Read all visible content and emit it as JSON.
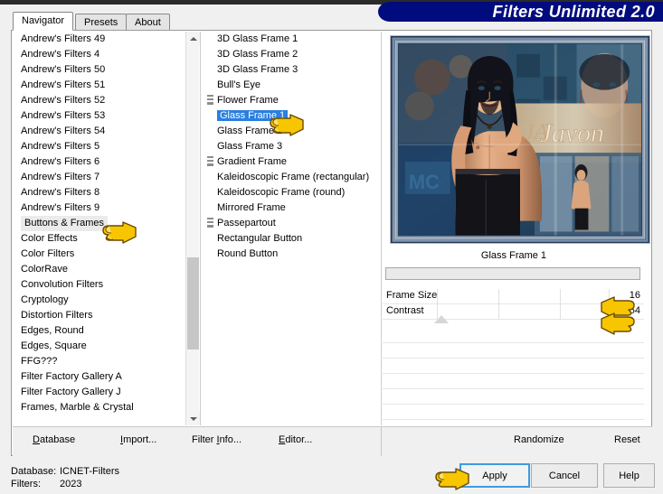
{
  "window": {
    "banner_title": "Filters Unlimited 2.0",
    "banner_color": "#000b7e"
  },
  "tabs": [
    {
      "label": "Navigator",
      "active": true
    },
    {
      "label": "Presets",
      "active": false
    },
    {
      "label": "About",
      "active": false
    }
  ],
  "categories": {
    "selected": "Buttons & Frames",
    "items": [
      "Andrew's Filters 49",
      "Andrew's Filters 4",
      "Andrew's Filters 50",
      "Andrew's Filters 51",
      "Andrew's Filters 52",
      "Andrew's Filters 53",
      "Andrew's Filters 54",
      "Andrew's Filters 5",
      "Andrew's Filters 6",
      "Andrew's Filters 7",
      "Andrew's Filters 8",
      "Andrew's Filters 9",
      "Buttons & Frames",
      "Color Effects",
      "Color Filters",
      "ColorRave",
      "Convolution Filters",
      "Cryptology",
      "Distortion Filters",
      "Edges, Round",
      "Edges, Square",
      "FFG???",
      "Filter Factory Gallery A",
      "Filter Factory Gallery J",
      "Frames, Marble & Crystal"
    ]
  },
  "filters": {
    "selected": "Glass Frame 1",
    "items": [
      {
        "label": "3D Glass Frame 1",
        "icon": false
      },
      {
        "label": "3D Glass Frame 2",
        "icon": false
      },
      {
        "label": "3D Glass Frame 3",
        "icon": false
      },
      {
        "label": "Bull's Eye",
        "icon": false
      },
      {
        "label": "Flower Frame",
        "icon": true
      },
      {
        "label": "Glass Frame 1",
        "icon": false
      },
      {
        "label": "Glass Frame 2",
        "icon": false
      },
      {
        "label": "Glass Frame 3",
        "icon": false
      },
      {
        "label": "Gradient Frame",
        "icon": true
      },
      {
        "label": "Kaleidoscopic Frame (rectangular)",
        "icon": false
      },
      {
        "label": "Kaleidoscopic Frame (round)",
        "icon": false
      },
      {
        "label": "Mirrored Frame",
        "icon": false
      },
      {
        "label": "Passepartout",
        "icon": true
      },
      {
        "label": "Rectangular Button",
        "icon": false
      },
      {
        "label": "Round Button",
        "icon": false
      }
    ]
  },
  "preview": {
    "caption": "Glass Frame 1",
    "artwork_text": "Javon"
  },
  "parameters": [
    {
      "label": "Frame Size",
      "value": "16"
    },
    {
      "label": "Contrast",
      "value": "54"
    }
  ],
  "action_bar": {
    "database": "Database",
    "database_accel": "D",
    "import": "Import...",
    "import_accel": "I",
    "filter_info": "Filter Info...",
    "filter_info_accel": "I",
    "editor": "Editor...",
    "editor_accel": "E",
    "randomize": "Randomize",
    "reset": "Reset"
  },
  "footer": {
    "database_label": "Database:",
    "database_value": "ICNET-Filters",
    "filters_label": "Filters:",
    "filters_value": "2023",
    "apply": "Apply",
    "cancel": "Cancel",
    "help": "Help"
  }
}
